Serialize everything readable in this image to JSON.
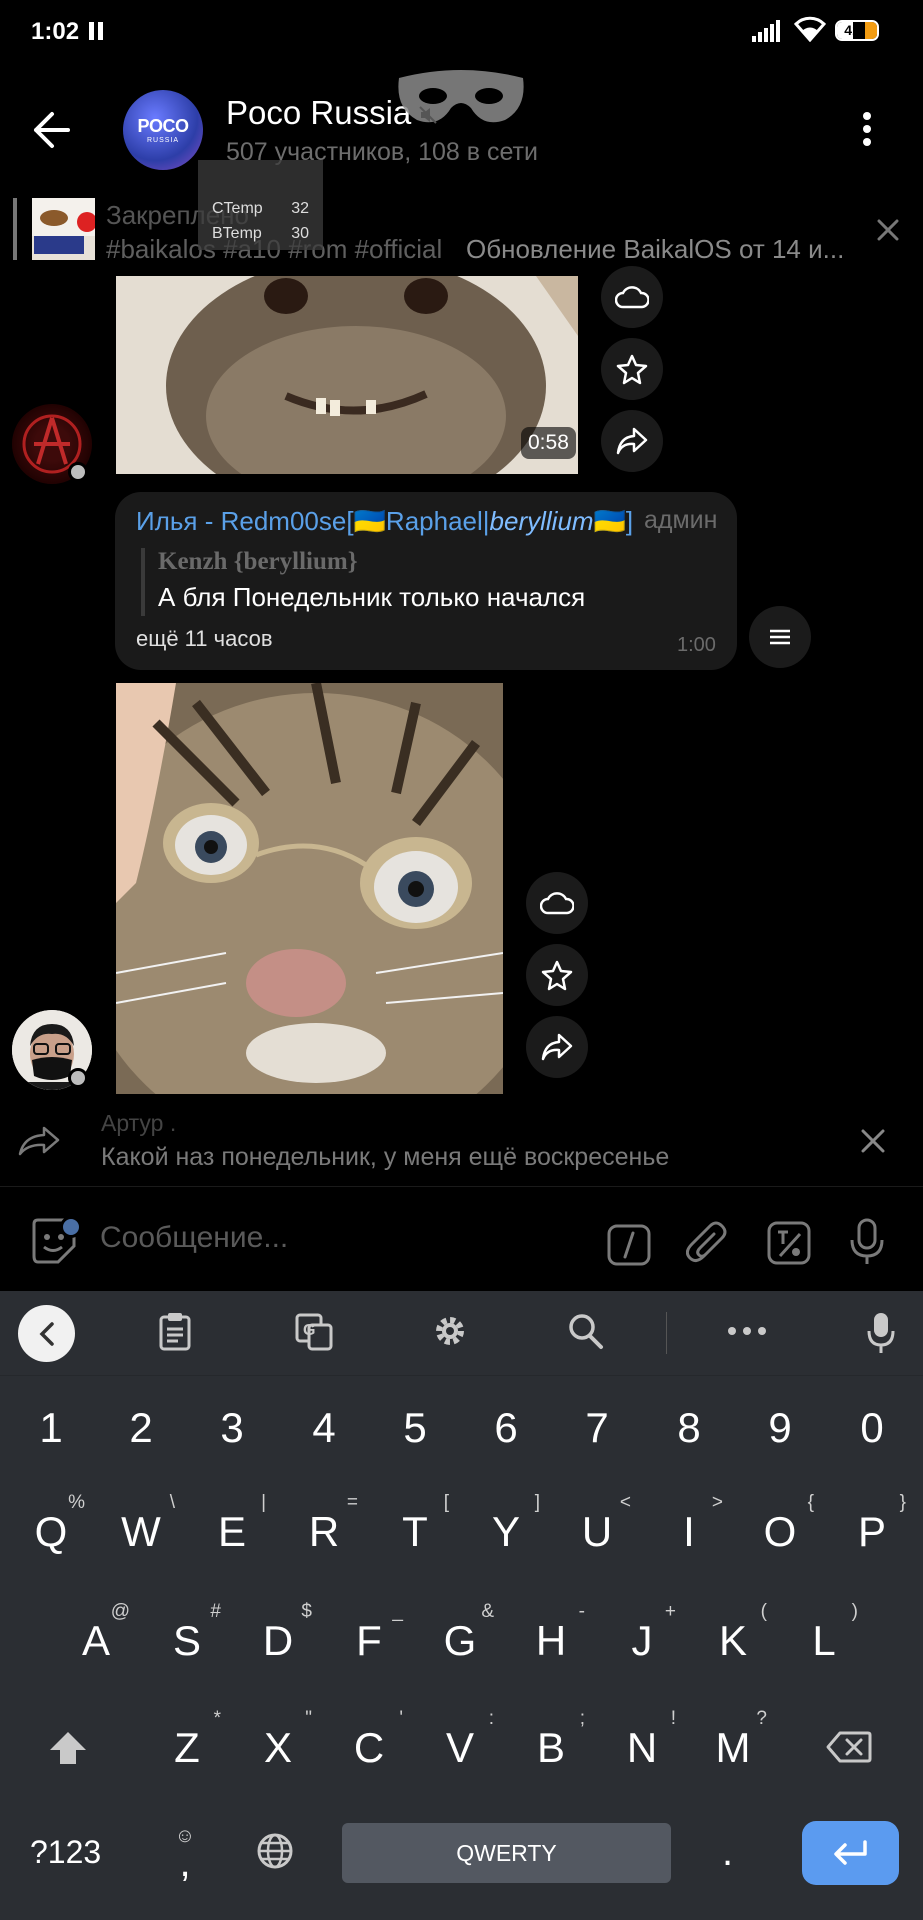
{
  "status_bar": {
    "time": "1:02",
    "battery": "41",
    "battery_level": 0.41
  },
  "header": {
    "title": "Poco Russia",
    "subtitle": "507 участников, 108 в сети",
    "avatar_text": "POCO",
    "avatar_subtext": "RUSSIA"
  },
  "overlay": {
    "rows": [
      {
        "label": "CTemp",
        "value": "32"
      },
      {
        "label": "BTemp",
        "value": "30"
      }
    ]
  },
  "pinned": {
    "label": "Закреплено",
    "tags": "#baikalos #a10 #rom #official",
    "text": "Обновление BaikalOS от 14 и..."
  },
  "messages": {
    "video": {
      "duration": "0:58"
    },
    "bubble": {
      "author_prefix": "Илья - Redm00se[🇺🇦Raphael|",
      "author_italic": "beryllium",
      "author_suffix": "🇺🇦]",
      "role": "админ",
      "quote_author": "Kenzh {beryllium}",
      "quote_text": "А бля Понедельник только начался",
      "text": "ещё 11 часов",
      "time": "1:00"
    }
  },
  "reply": {
    "author": "Артур .",
    "text": "Какой наз понедельник, у меня ещё воскресенье"
  },
  "input": {
    "placeholder": "Сообщение..."
  },
  "keyboard": {
    "space_label": "QWERTY",
    "symbols_label": "?123",
    "comma": ",",
    "comma_alt": "☺",
    "dot": ".",
    "number_row": [
      "1",
      "2",
      "3",
      "4",
      "5",
      "6",
      "7",
      "8",
      "9",
      "0"
    ],
    "row1": [
      {
        "k": "Q",
        "a": "%"
      },
      {
        "k": "W",
        "a": "\\"
      },
      {
        "k": "E",
        "a": "|"
      },
      {
        "k": "R",
        "a": "="
      },
      {
        "k": "T",
        "a": "["
      },
      {
        "k": "Y",
        "a": "]"
      },
      {
        "k": "U",
        "a": "<"
      },
      {
        "k": "I",
        "a": ">"
      },
      {
        "k": "O",
        "a": "{"
      },
      {
        "k": "P",
        "a": "}"
      }
    ],
    "row2": [
      {
        "k": "A",
        "a": "@"
      },
      {
        "k": "S",
        "a": "#"
      },
      {
        "k": "D",
        "a": "$"
      },
      {
        "k": "F",
        "a": "_"
      },
      {
        "k": "G",
        "a": "&"
      },
      {
        "k": "H",
        "a": "-"
      },
      {
        "k": "J",
        "a": "+"
      },
      {
        "k": "K",
        "a": "("
      },
      {
        "k": "L",
        "a": ")"
      }
    ],
    "row3": [
      {
        "k": "Z",
        "a": "*"
      },
      {
        "k": "X",
        "a": "\""
      },
      {
        "k": "C",
        "a": "'"
      },
      {
        "k": "V",
        "a": ":"
      },
      {
        "k": "B",
        "a": ";"
      },
      {
        "k": "N",
        "a": "!"
      },
      {
        "k": "M",
        "a": "?"
      }
    ]
  },
  "icons": {
    "back": "arrow-left-icon",
    "menu": "more-vertical-icon",
    "cloud": "cloud-icon",
    "star": "star-icon",
    "share": "share-icon",
    "reply": "reply-arrow-icon",
    "close": "close-icon",
    "emoji": "emoji-icon",
    "command": "slash-command-icon",
    "attach": "paperclip-icon",
    "sticker": "sticker-icon",
    "mic": "microphone-icon"
  },
  "colors": {
    "background": "#000000",
    "name_blue": "#5aa0e8",
    "bubble": "#1a1a1a",
    "keyboard": "#2b2e33",
    "enter_key": "#5b9bf0"
  }
}
